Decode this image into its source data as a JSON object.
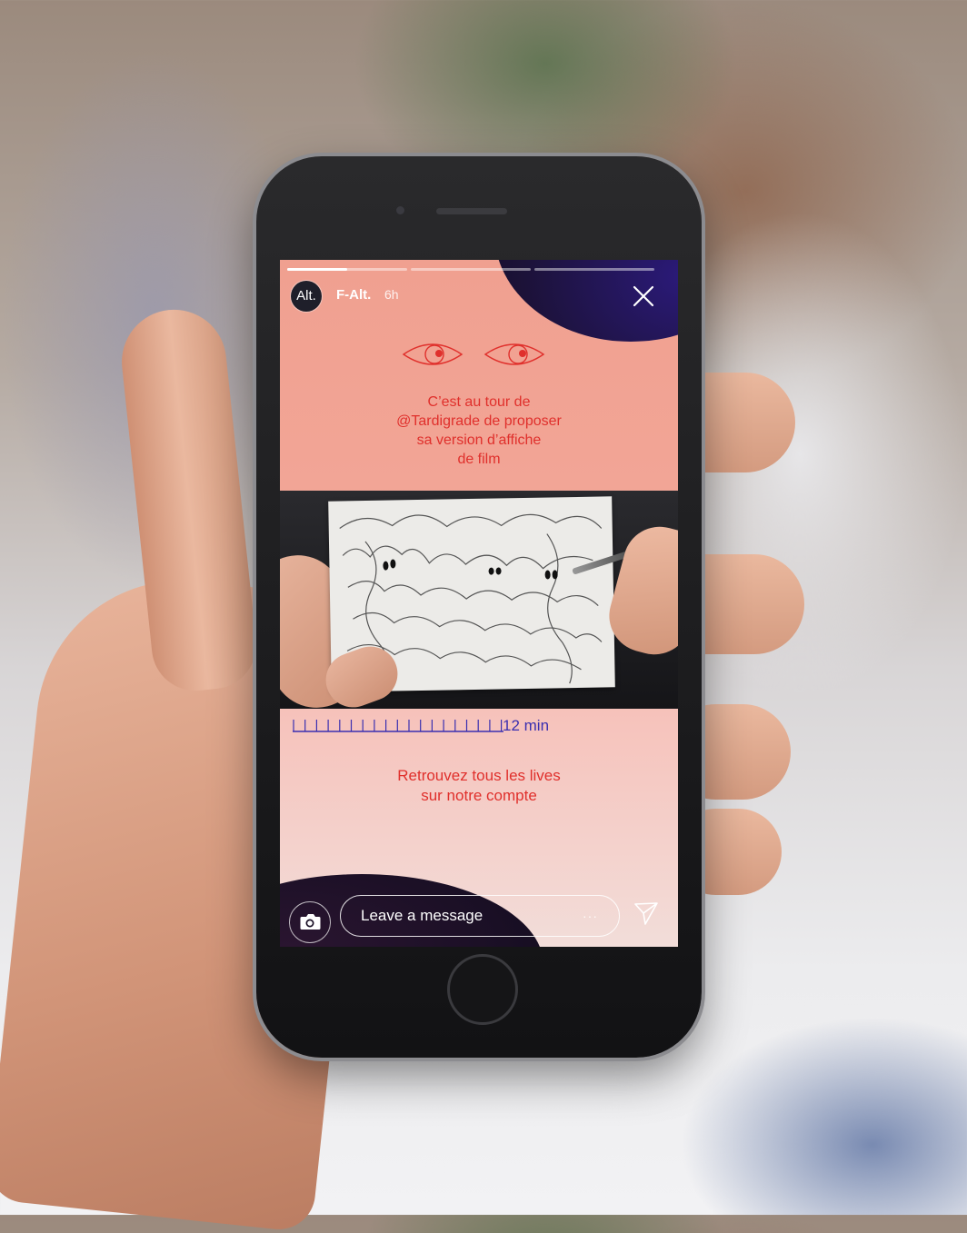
{
  "story": {
    "username": "F-Alt.",
    "avatar_text": "Alt.",
    "time_ago": "6h",
    "segments_filled": [
      0.5,
      0,
      0
    ],
    "intro_lines": [
      "C’est au tour de",
      "@Tardigrade de proposer",
      "sa version d’affiche",
      "de film"
    ],
    "duration_label": "12 min",
    "outro_lines": [
      "Retrouvez tous les lives",
      "sur notre compte"
    ]
  },
  "reply_bar": {
    "placeholder": "Leave a message",
    "more_label": "···"
  },
  "colors": {
    "accent_red": "#e0302c",
    "accent_purple": "#3a2fb0",
    "background_pink": "#f0a090"
  },
  "icons": {
    "close": "close-icon",
    "camera": "camera-icon",
    "send": "send-icon",
    "more": "more-dots-icon",
    "eyes": "eyes-icon"
  }
}
